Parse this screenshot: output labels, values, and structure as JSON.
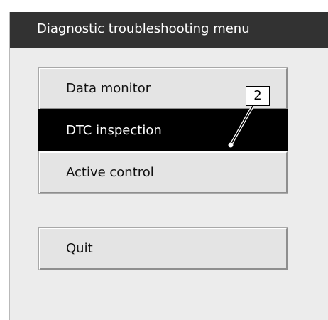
{
  "window": {
    "title": "Diagnostic troubleshooting menu"
  },
  "menu": {
    "items": [
      {
        "label": "Data monitor",
        "selected": false
      },
      {
        "label": "DTC inspection",
        "selected": true
      },
      {
        "label": "Active control",
        "selected": false
      }
    ],
    "quit_label": "Quit"
  },
  "callout": {
    "number": "2"
  },
  "colors": {
    "titlebar": "#323232",
    "window_bg": "#ececec",
    "button_bg": "#e4e4e4",
    "selected_bg": "#000000",
    "selected_text": "#ffffff"
  }
}
